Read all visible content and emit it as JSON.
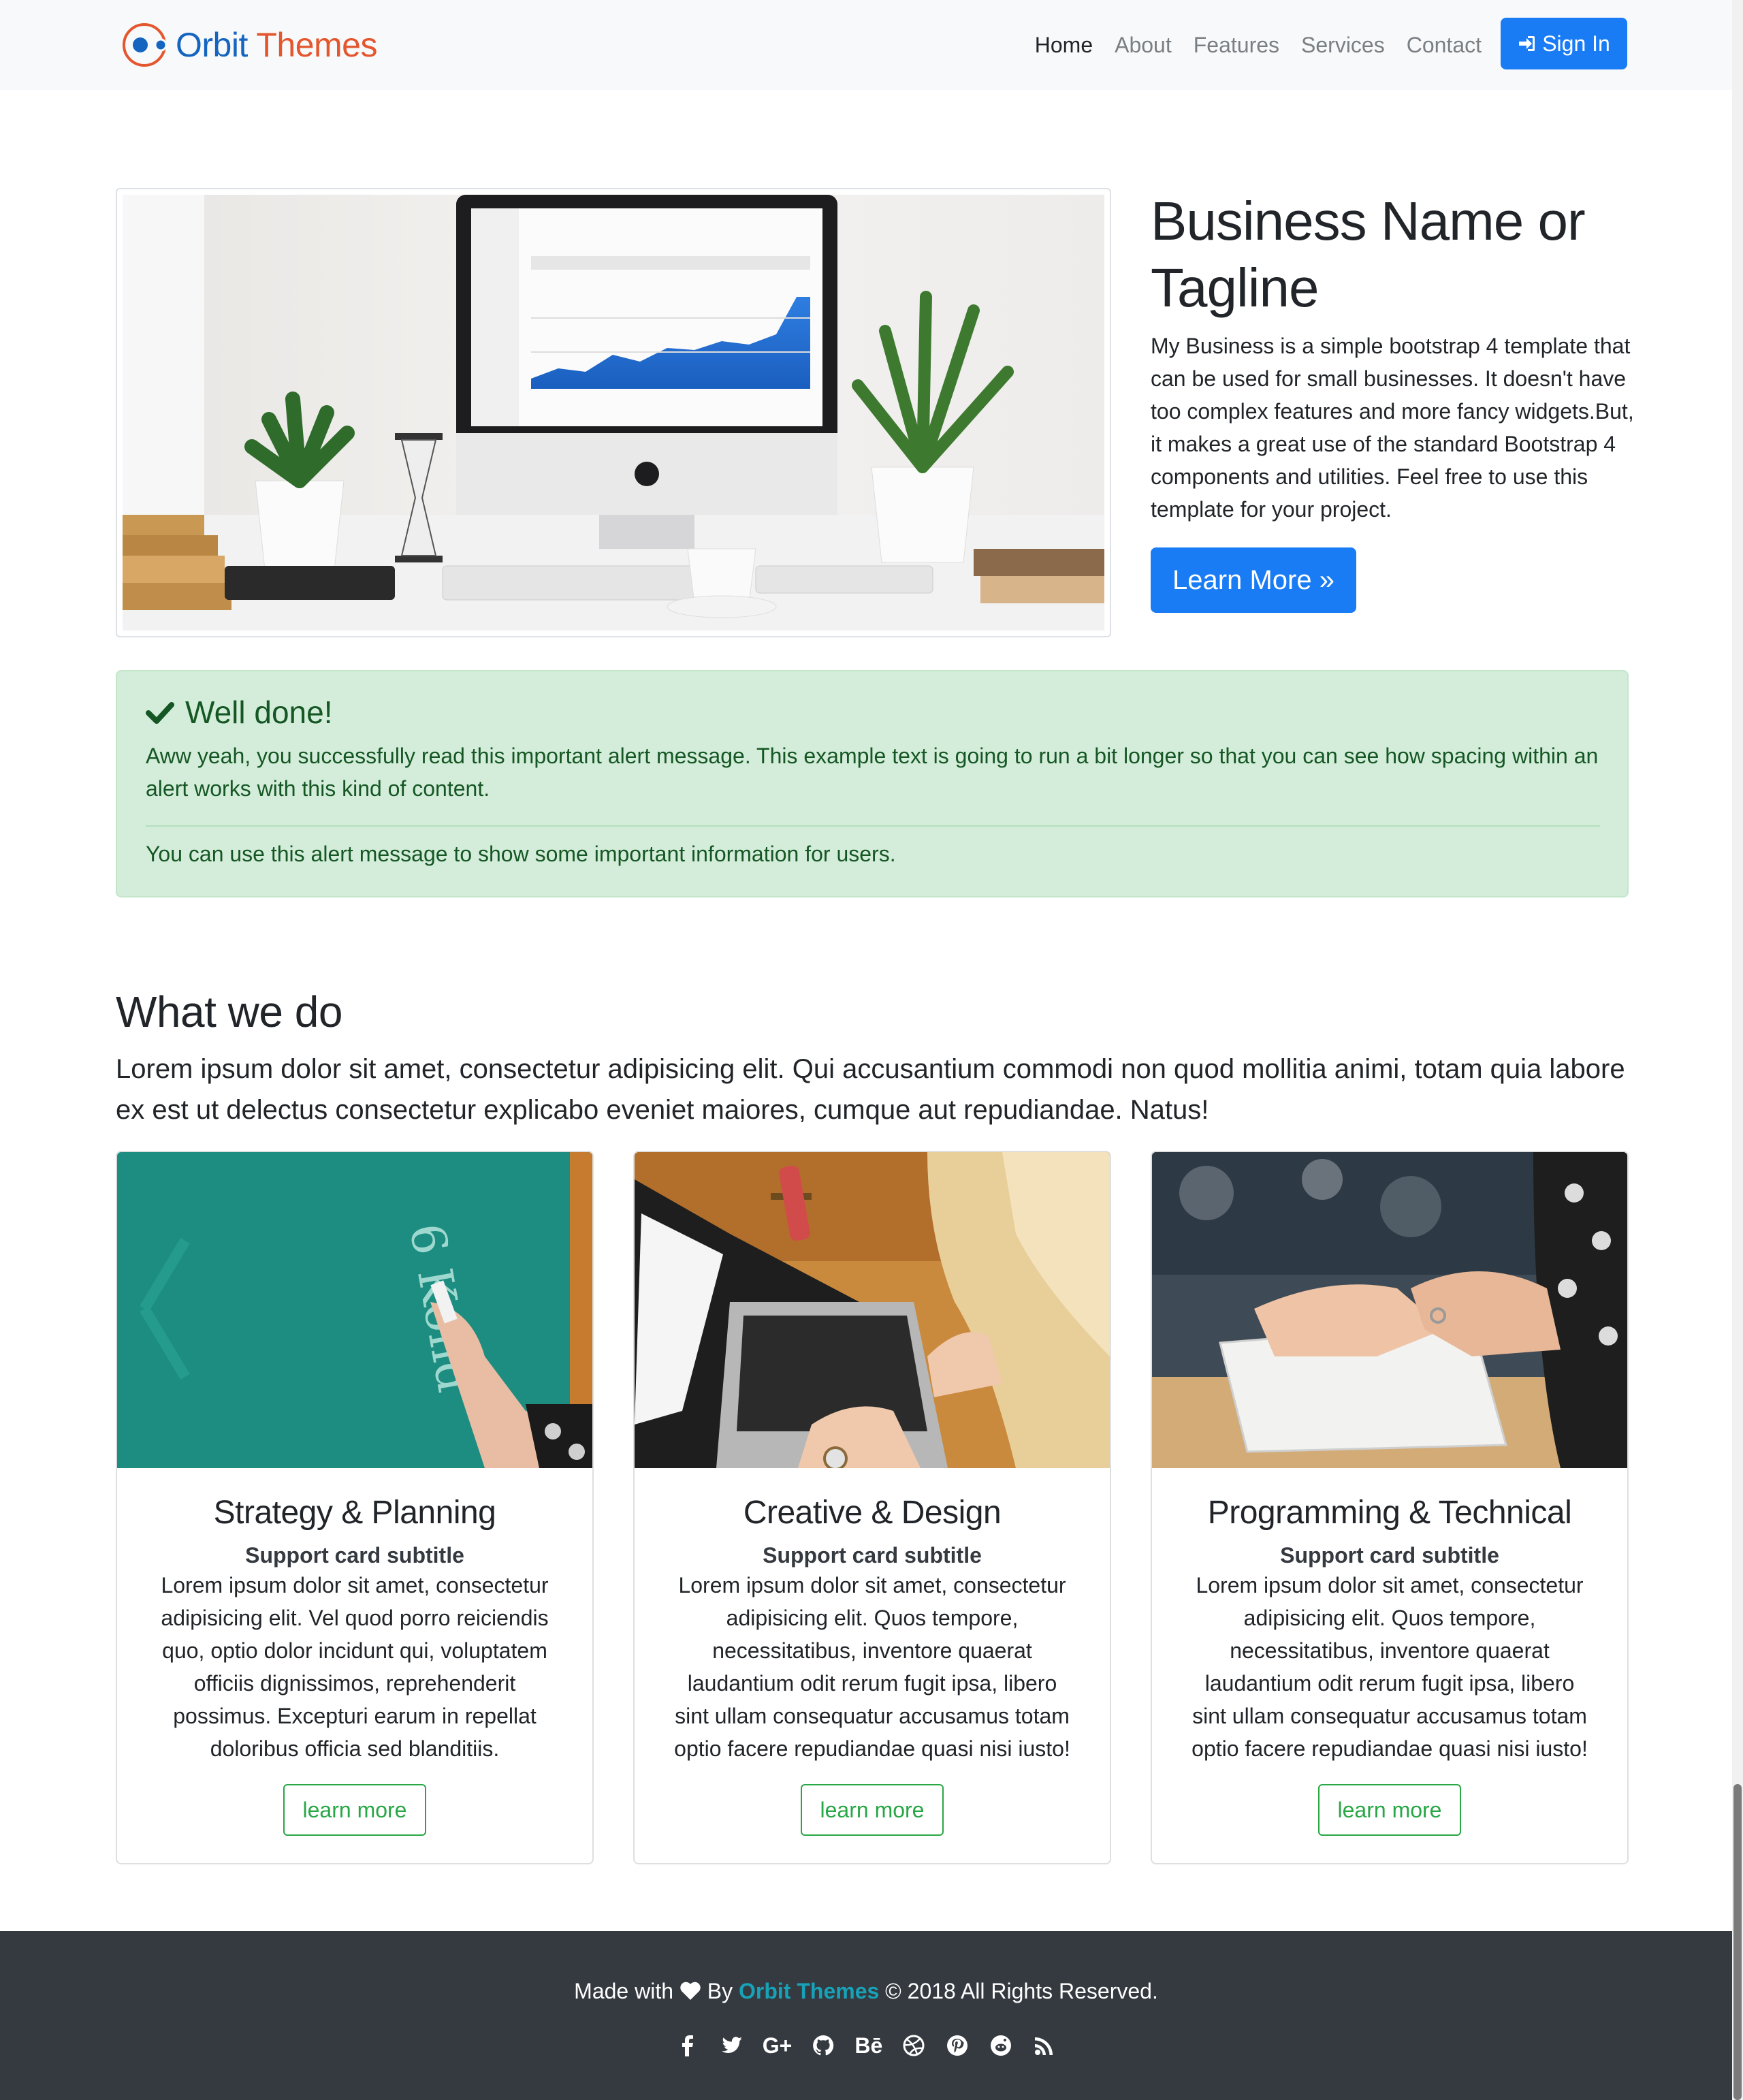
{
  "nav": {
    "brand_first": "Orbit",
    "brand_second": "Themes",
    "links": [
      {
        "label": "Home",
        "active": true
      },
      {
        "label": "About"
      },
      {
        "label": "Features"
      },
      {
        "label": "Services"
      },
      {
        "label": "Contact"
      }
    ],
    "signin_label": "Sign In"
  },
  "hero": {
    "title": "Business Name or Tagline",
    "description": "My Business is a simple bootstrap 4 template that can be used for small businesses. It doesn't have too complex features and more fancy widgets.But, it makes a great use of the standard Bootstrap 4 components and utilities. Feel free to use this template for your project.",
    "button_label": "Learn More »"
  },
  "alert": {
    "heading": "Well done!",
    "text": "Aww yeah, you successfully read this important alert message. This example text is going to run a bit longer so that you can see how spacing within an alert works with this kind of content.",
    "text2": "You can use this alert message to show some important information for users."
  },
  "section": {
    "title": "What we do",
    "lead": "Lorem ipsum dolor sit amet, consectetur adipisicing elit. Qui accusantium commodi non quod mollitia animi, totam quia labore ex est ut delectus consectetur explicabo eveniet maiores, cumque aut repudiandae. Natus!"
  },
  "cards": [
    {
      "title": "Strategy & Planning",
      "subtitle": "Support card subtitle",
      "text": "Lorem ipsum dolor sit amet, consectetur adipisicing elit. Vel quod porro reiciendis quo, optio dolor incidunt qui, voluptatem officiis dignissimos, reprehenderit possimus. Excepturi earum in repellat doloribus officia sed blanditiis.",
      "button": "learn more"
    },
    {
      "title": "Creative & Design",
      "subtitle": "Support card subtitle",
      "text": "Lorem ipsum dolor sit amet, consectetur adipisicing elit. Quos tempore, necessitatibus, inventore quaerat laudantium odit rerum fugit ipsa, libero sint ullam consequatur accusamus totam optio facere repudiandae quasi nisi iusto!",
      "button": "learn more"
    },
    {
      "title": "Programming & Technical",
      "subtitle": "Support card subtitle",
      "text": "Lorem ipsum dolor sit amet, consectetur adipisicing elit. Quos tempore, necessitatibus, inventore quaerat laudantium odit rerum fugit ipsa, libero sint ullam consequatur accusamus totam optio facere repudiandae quasi nisi iusto!",
      "button": "learn more"
    }
  ],
  "footer": {
    "made_with": "Made with",
    "by": "By",
    "brand": "Orbit Themes",
    "rights": "© 2018 All Rights Reserved.",
    "social": [
      "facebook-icon",
      "twitter-icon",
      "google-plus-icon",
      "github-icon",
      "behance-icon",
      "dribbble-icon",
      "pinterest-icon",
      "reddit-icon",
      "rss-icon"
    ],
    "gplus_text": "G+",
    "behance_text": "Bē"
  },
  "colors": {
    "primary": "#1a7cf5",
    "success": "#28a745",
    "alert_bg": "#d4edda",
    "alert_text": "#155724",
    "footer_bg": "#343a40",
    "footer_brand": "#17a2b8",
    "brand_blue": "#1565c0",
    "brand_orange": "#e4572e"
  }
}
